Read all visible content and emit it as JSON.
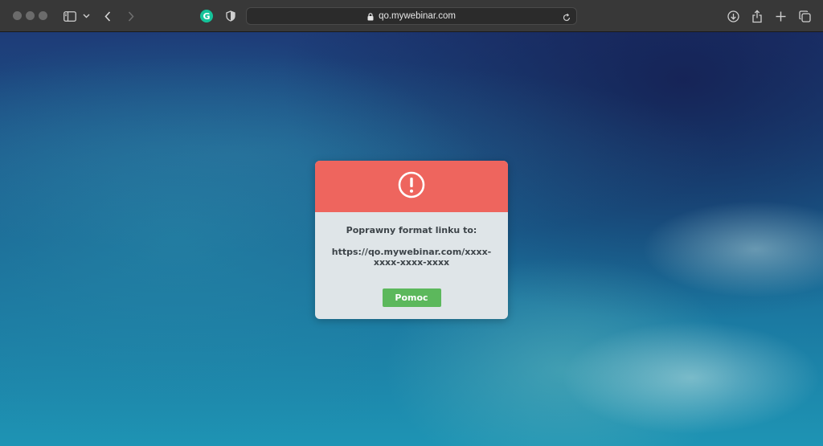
{
  "browser": {
    "url": "qo.mywebinar.com",
    "extension_grammarly_letter": "G"
  },
  "dialog": {
    "title": "Poprawny format linku to:",
    "url_format": "https://qo.mywebinar.com/xxxx-xxxx-xxxx-xxxx",
    "help_button_label": "Pomoc",
    "header_color": "#ee655e",
    "button_color": "#5cb85c"
  },
  "icons": {
    "toolbar_left": [
      "sidebar-icon",
      "chevron-down-icon",
      "back-icon",
      "forward-icon"
    ],
    "extensions": [
      "grammarly-icon",
      "privacy-shield-icon"
    ],
    "address_bar": [
      "lock-icon",
      "reload-icon"
    ],
    "toolbar_right": [
      "download-icon",
      "share-icon",
      "new-tab-icon",
      "tab-overview-icon"
    ],
    "dialog": "alert-icon"
  }
}
